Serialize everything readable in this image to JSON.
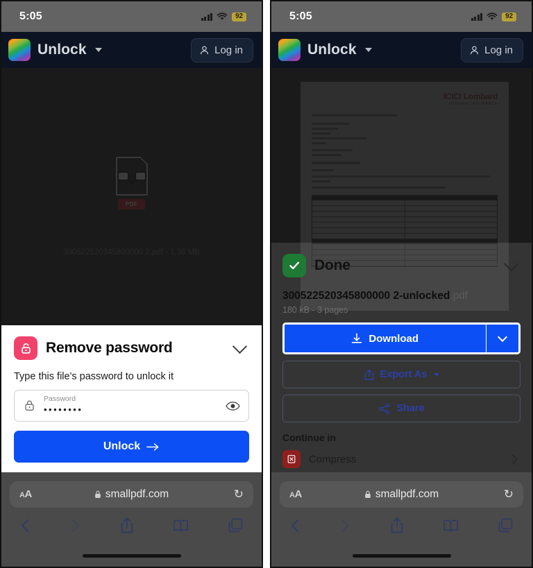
{
  "status_bar": {
    "time": "5:05",
    "cellular_icon": "cellular-bars-icon",
    "wifi_icon": "wifi-icon",
    "battery_level": "92"
  },
  "app_header": {
    "logo_icon": "smallpdf-logo-icon",
    "title": "Unlock",
    "dropdown_icon": "chevron-down-icon",
    "login_label": "Log in",
    "login_icon": "person-icon",
    "background_color": "#0c1423"
  },
  "left_panel": {
    "file_preview": {
      "icon": "pdf-document-with-glasses-icon",
      "badge": "PDF",
      "caption": "300522520345800000 2.pdf - 1.38 MB"
    },
    "sheet": {
      "icon": "open-padlock-icon",
      "icon_color": "#f2426b",
      "title": "Remove password",
      "collapse_icon": "chevron-down-icon",
      "subtitle": "Type this file's password to unlock it",
      "password_field": {
        "lock_icon": "lock-icon",
        "label": "Password",
        "value": "••••••••",
        "reveal_icon": "eye-icon"
      },
      "submit_label": "Unlock",
      "submit_arrow": "arrow-right-icon",
      "submit_color": "#0b4ff5"
    }
  },
  "right_panel": {
    "pdf_preview": {
      "brand_line_1": "ICICI Lombard",
      "brand_line_2": "GENERAL INSURANCE"
    },
    "sheet": {
      "icon": "green-checkmark-icon",
      "icon_color": "#1e7a34",
      "title": "Done",
      "collapse_icon": "chevron-down-icon",
      "file_name": "300522520345800000 2-unlocked",
      "file_ext": ".pdf",
      "file_meta": "180 kB - 3 pages",
      "download_label": "Download",
      "download_icon": "download-icon",
      "download_caret_icon": "chevron-down-icon",
      "download_color": "#0b4ff5",
      "export_label": "Export As",
      "export_icon": "share-up-icon",
      "share_label": "Share",
      "share_icon": "share-nodes-icon",
      "continue_label": "Continue in",
      "continue_items": [
        {
          "icon": "compress-icon",
          "icon_color": "#8f1f1f",
          "label": "Compress",
          "chevron": "chevron-right-icon"
        }
      ]
    }
  },
  "safari": {
    "text_size_small": "A",
    "text_size_large": "A",
    "lock_icon": "lock-icon",
    "url": "smallpdf.com",
    "reload_icon": "reload-icon",
    "toolbar": {
      "back_icon": "chevron-left-icon",
      "forward_icon": "chevron-right-icon",
      "share_icon": "share-icon",
      "bookmarks_icon": "book-icon",
      "tabs_icon": "tabs-icon"
    }
  }
}
